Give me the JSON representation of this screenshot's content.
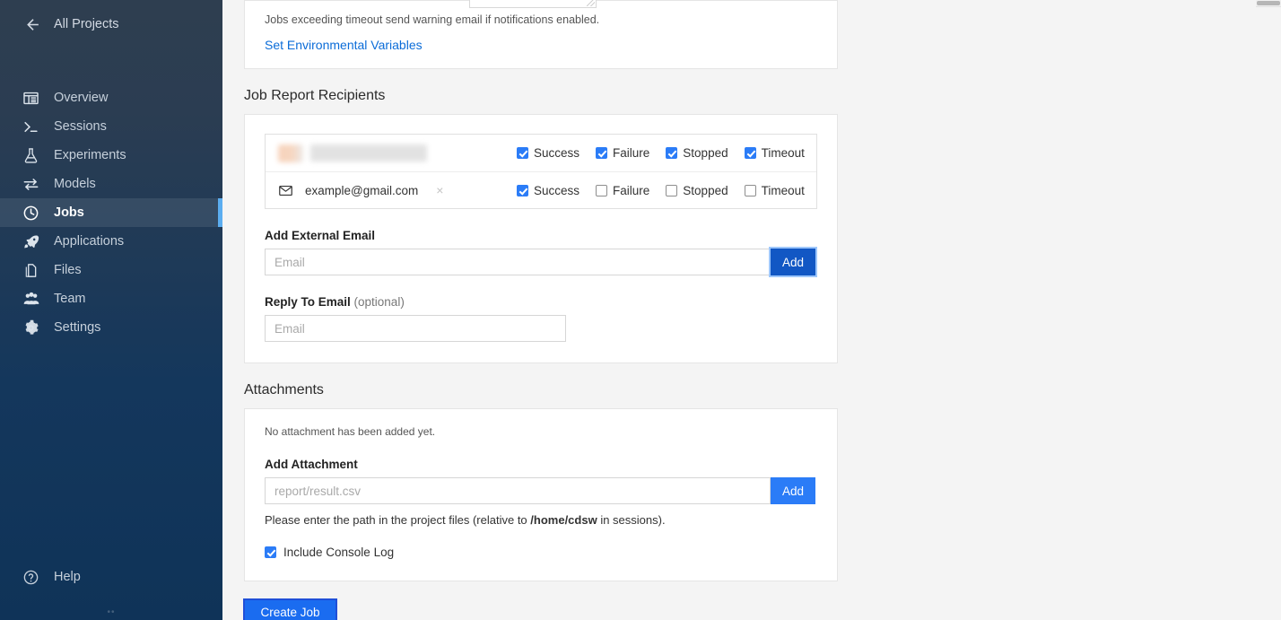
{
  "sidebar": {
    "back_label": "All Projects",
    "back_icon": "arrow-left-icon",
    "items": [
      {
        "label": "Overview",
        "icon": "overview-icon",
        "active": false
      },
      {
        "label": "Sessions",
        "icon": "terminal-icon",
        "active": false
      },
      {
        "label": "Experiments",
        "icon": "flask-icon",
        "active": false
      },
      {
        "label": "Models",
        "icon": "exchange-icon",
        "active": false
      },
      {
        "label": "Jobs",
        "icon": "clock-icon",
        "active": true
      },
      {
        "label": "Applications",
        "icon": "rocket-icon",
        "active": false
      },
      {
        "label": "Files",
        "icon": "files-icon",
        "active": false
      },
      {
        "label": "Team",
        "icon": "team-icon",
        "active": false
      },
      {
        "label": "Settings",
        "icon": "gear-icon",
        "active": false
      }
    ],
    "help_label": "Help",
    "help_icon": "question-circle-icon",
    "footer_mark": "••"
  },
  "timeout_card": {
    "hint": "Jobs exceeding timeout send warning email if notifications enabled.",
    "env_link": "Set Environmental Variables"
  },
  "recipients": {
    "title": "Job Report Recipients",
    "rows": [
      {
        "redacted": true,
        "email": "",
        "icon": "",
        "checks": [
          {
            "label": "Success",
            "checked": true
          },
          {
            "label": "Failure",
            "checked": true
          },
          {
            "label": "Stopped",
            "checked": true
          },
          {
            "label": "Timeout",
            "checked": true
          }
        ]
      },
      {
        "redacted": false,
        "email": "example@gmail.com",
        "icon": "envelope-icon",
        "remove": "×",
        "checks": [
          {
            "label": "Success",
            "checked": true
          },
          {
            "label": "Failure",
            "checked": false
          },
          {
            "label": "Stopped",
            "checked": false
          },
          {
            "label": "Timeout",
            "checked": false
          }
        ]
      }
    ],
    "add_external_label": "Add External Email",
    "add_external_placeholder": "Email",
    "add_external_value": "",
    "add_button": "Add",
    "reply_label": "Reply To Email",
    "reply_label_optional": " (optional)",
    "reply_placeholder": "Email",
    "reply_value": ""
  },
  "attachments": {
    "title": "Attachments",
    "empty_note": "No attachment has been added yet.",
    "add_label": "Add Attachment",
    "add_placeholder": "report/result.csv",
    "add_value": "",
    "add_button": "Add",
    "path_note_prefix": "Please enter the path in the project files (relative to ",
    "path_note_bold": "/home/cdsw",
    "path_note_suffix": " in sessions).",
    "console_log_label": "Include Console Log",
    "console_log_checked": true
  },
  "footer": {
    "create_button": "Create Job"
  },
  "colors": {
    "accent_blue": "#2b7cf7",
    "link_blue": "#0b6cd8",
    "sidebar_top": "#2e3e50",
    "sidebar_bottom": "#0f3358",
    "active_indicator": "#5badf0",
    "page_bg": "#f4f4f4"
  }
}
